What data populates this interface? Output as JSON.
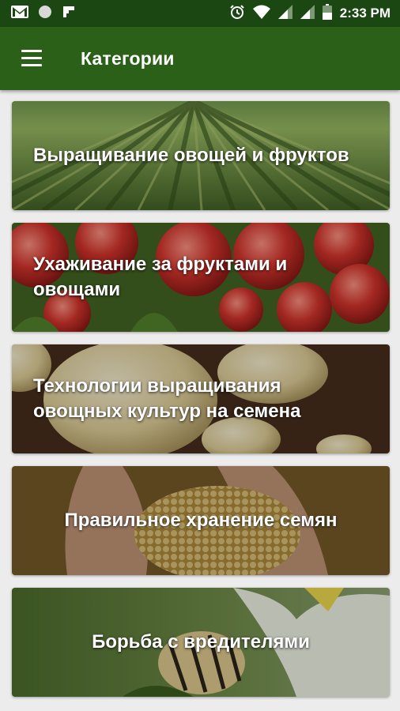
{
  "status_bar": {
    "time": "2:33 PM",
    "icons": [
      "gmail-icon",
      "circle-icon",
      "flipboard-icon",
      "alarm-icon",
      "wifi-icon",
      "signal-icon",
      "signal-icon",
      "battery-icon"
    ]
  },
  "app_bar": {
    "title": "Категории",
    "menu_icon": "hamburger-menu-icon"
  },
  "categories": [
    {
      "label": "Выращивание овощей и фруктов"
    },
    {
      "label": "Ухаживание за фруктами и овощами"
    },
    {
      "label": "Технологии выращивания овощных культур на семена"
    },
    {
      "label": "Правильное хранение семян"
    },
    {
      "label": "Борьба с вредителями"
    }
  ],
  "colors": {
    "status_bar": "#1a4712",
    "app_bar": "#2a6018",
    "background": "#ececec"
  }
}
